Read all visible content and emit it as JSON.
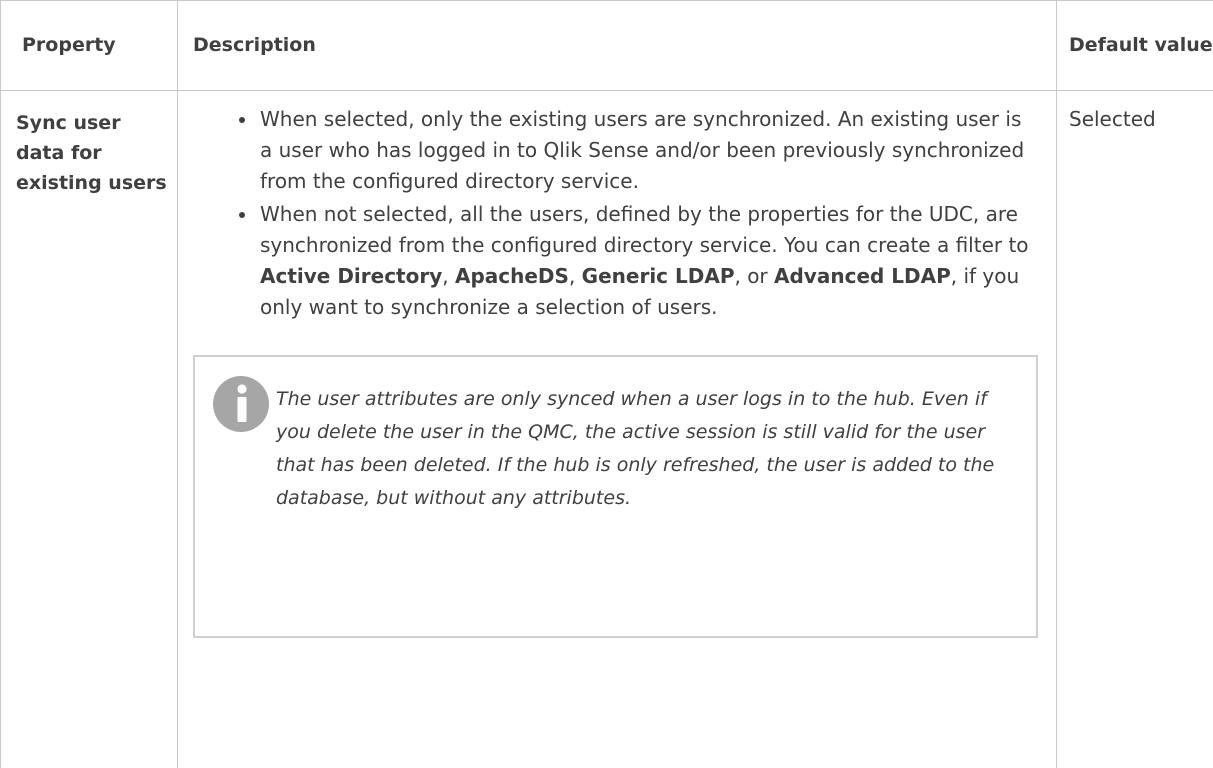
{
  "table": {
    "headers": {
      "property": "Property",
      "description": "Description",
      "default_value": "Default value"
    },
    "rows": [
      {
        "property": "Sync user data for existing users",
        "bullets": [
          {
            "text": "When selected, only the existing users are synchronized. An existing user is a user who has logged in to Qlik Sense and/or been previously synchronized from the configured directory service."
          },
          {
            "text_1": "When not selected, all the users, defined by the properties for the UDC, are synchronized from the configured directory service. You can create a filter to ",
            "bold_1": "Active Directory",
            "text_2": ", ",
            "bold_2": "ApacheDS",
            "text_3": ", ",
            "bold_3": "Generic LDAP",
            "text_4": ", or ",
            "bold_4": "Advanced LDAP",
            "text_5": ", if you only want to synchronize a selection of users."
          }
        ],
        "note": {
          "icon": "info-icon",
          "text": "The user attributes are only synced when a user logs in to the hub. Even if you delete the user in the QMC, the active session is still valid for the user that has been deleted. If the hub is only refreshed, the user is added to the database, but without any attributes."
        },
        "default_value": "Selected"
      }
    ]
  },
  "colors": {
    "text": "#404040",
    "border": "#c8c8c8",
    "icon": "#a6a6a6"
  }
}
